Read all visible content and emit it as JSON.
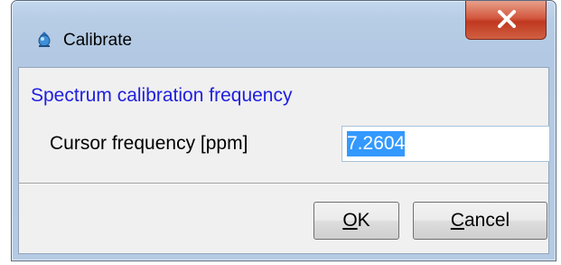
{
  "window": {
    "title": "Calibrate",
    "close_symbol": "x"
  },
  "dialog": {
    "section_title": "Spectrum calibration frequency",
    "field_label": "Cursor frequency [ppm]",
    "field_value": "7.2604"
  },
  "buttons": {
    "ok_mnemonic": "O",
    "ok_rest": "K",
    "cancel_mnemonic": "C",
    "cancel_rest": "ancel"
  },
  "icons": {
    "app": "app-icon",
    "close": "close-icon"
  },
  "colors": {
    "section_title": "#2020e0",
    "selection": "#3399ff",
    "close_button": "#c94a30"
  }
}
